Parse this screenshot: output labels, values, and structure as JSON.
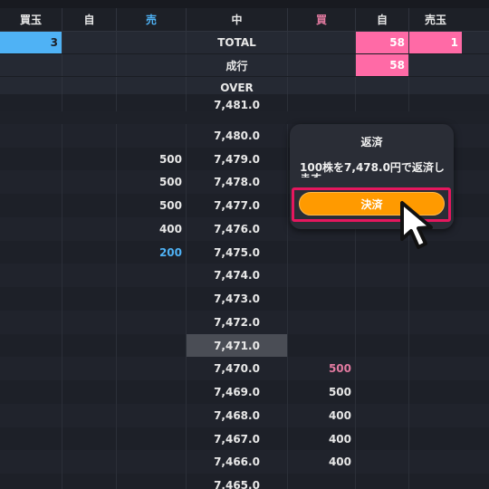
{
  "header": {
    "cols": [
      "買玉",
      "自",
      "売",
      "中",
      "買",
      "自",
      "売玉"
    ]
  },
  "summary": {
    "total_label": "TOTAL",
    "market_label": "成行",
    "over_label": "OVER",
    "buy_position": "3",
    "total_right": "58",
    "total_far_right": "1",
    "market_right": "58"
  },
  "ladder": [
    {
      "price": "7,481.0",
      "ask": "",
      "bid": ""
    },
    {
      "price": "7,480.0",
      "ask": "",
      "bid": ""
    },
    {
      "price": "7,479.0",
      "ask": "500",
      "bid": ""
    },
    {
      "price": "7,478.0",
      "ask": "500",
      "bid": ""
    },
    {
      "price": "7,477.0",
      "ask": "500",
      "bid": ""
    },
    {
      "price": "7,476.0",
      "ask": "400",
      "bid": ""
    },
    {
      "price": "7,475.0",
      "ask": "200",
      "bid": ""
    },
    {
      "price": "7,474.0",
      "ask": "",
      "bid": ""
    },
    {
      "price": "7,473.0",
      "ask": "",
      "bid": ""
    },
    {
      "price": "7,472.0",
      "ask": "",
      "bid": ""
    },
    {
      "price": "7,471.0",
      "ask": "",
      "bid": ""
    },
    {
      "price": "7,470.0",
      "ask": "",
      "bid": "500"
    },
    {
      "price": "7,469.0",
      "ask": "",
      "bid": "500"
    },
    {
      "price": "7,468.0",
      "ask": "",
      "bid": "400"
    },
    {
      "price": "7,467.0",
      "ask": "",
      "bid": "400"
    },
    {
      "price": "7,466.0",
      "ask": "",
      "bid": "400"
    },
    {
      "price": "7,465.0",
      "ask": "",
      "bid": ""
    }
  ],
  "popup": {
    "title": "返済",
    "message": "100株を7,478.0円で返済し",
    "message_cont": "ます",
    "button_label": "決済"
  },
  "colors": {
    "ask": "#4fb2f5",
    "bid": "#ff6aa6",
    "button": "#ff9a00",
    "highlight_frame": "#e5175e"
  }
}
